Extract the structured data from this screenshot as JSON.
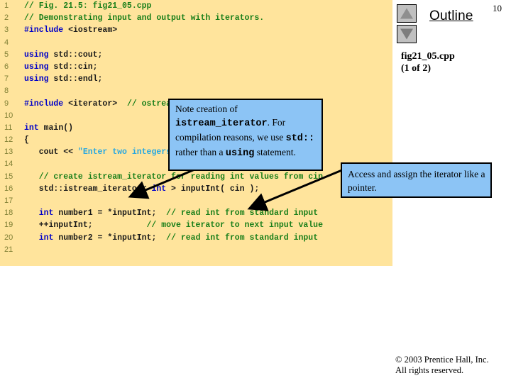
{
  "slide": {
    "number": "10",
    "outline_title": "Outline",
    "file_label_line1": "fig21_05.cpp",
    "file_label_line2": "(1 of 2)",
    "footer_line1": "© 2003 Prentice Hall, Inc.",
    "footer_line2": "All rights reserved."
  },
  "nav": {
    "up_icon": "triangle-up-icon",
    "down_icon": "triangle-down-icon"
  },
  "code": {
    "lines": [
      {
        "n": "1",
        "segments": [
          {
            "t": "// Fig. 21.5: fig21_05.cpp",
            "c": "cmt"
          }
        ]
      },
      {
        "n": "2",
        "segments": [
          {
            "t": "// Demonstrating input and output with iterators.",
            "c": "cmt"
          }
        ]
      },
      {
        "n": "3",
        "segments": [
          {
            "t": "#include",
            "c": "kw"
          },
          {
            "t": " <iostream>",
            "c": "pln"
          }
        ]
      },
      {
        "n": "4",
        "segments": []
      },
      {
        "n": "5",
        "segments": [
          {
            "t": "using",
            "c": "kw"
          },
          {
            "t": " std::cout;",
            "c": "pln"
          }
        ]
      },
      {
        "n": "6",
        "segments": [
          {
            "t": "using",
            "c": "kw"
          },
          {
            "t": " std::cin;",
            "c": "pln"
          }
        ]
      },
      {
        "n": "7",
        "segments": [
          {
            "t": "using",
            "c": "kw"
          },
          {
            "t": " std::endl;",
            "c": "pln"
          }
        ]
      },
      {
        "n": "8",
        "segments": []
      },
      {
        "n": "9",
        "segments": [
          {
            "t": "#include",
            "c": "kw"
          },
          {
            "t": " <iterator>  ",
            "c": "pln"
          },
          {
            "t": "// ostream_iterator and istream_iterator",
            "c": "cmt"
          }
        ]
      },
      {
        "n": "10",
        "segments": []
      },
      {
        "n": "11",
        "segments": [
          {
            "t": "int",
            "c": "kw"
          },
          {
            "t": " main()",
            "c": "pln"
          }
        ]
      },
      {
        "n": "12",
        "segments": [
          {
            "t": "{",
            "c": "pln"
          }
        ]
      },
      {
        "n": "13",
        "segments": [
          {
            "t": "   cout << ",
            "c": "pln"
          },
          {
            "t": "\"Enter two integers: \"",
            "c": "str"
          },
          {
            "t": ";",
            "c": "pln"
          }
        ]
      },
      {
        "n": "14",
        "segments": []
      },
      {
        "n": "15",
        "segments": [
          {
            "t": "   // create istream_iterator for reading int values from cin",
            "c": "cmt"
          }
        ]
      },
      {
        "n": "16",
        "segments": [
          {
            "t": "   std::istream_iterator< ",
            "c": "pln"
          },
          {
            "t": "int",
            "c": "kw"
          },
          {
            "t": " > inputInt( cin );",
            "c": "pln"
          }
        ]
      },
      {
        "n": "17",
        "segments": []
      },
      {
        "n": "18",
        "segments": [
          {
            "t": "   ",
            "c": "pln"
          },
          {
            "t": "int",
            "c": "kw"
          },
          {
            "t": " number1 = *inputInt;  ",
            "c": "pln"
          },
          {
            "t": "// read int from standard input",
            "c": "cmt"
          }
        ]
      },
      {
        "n": "19",
        "segments": [
          {
            "t": "   ++inputInt;           ",
            "c": "pln"
          },
          {
            "t": "// move iterator to next input value",
            "c": "cmt"
          }
        ]
      },
      {
        "n": "20",
        "segments": [
          {
            "t": "   ",
            "c": "pln"
          },
          {
            "t": "int",
            "c": "kw"
          },
          {
            "t": " number2 = *inputInt;  ",
            "c": "pln"
          },
          {
            "t": "// read int from standard input",
            "c": "cmt"
          }
        ]
      },
      {
        "n": "21",
        "segments": []
      }
    ]
  },
  "callouts": [
    {
      "id": "callout-note-creation",
      "parts": [
        {
          "t": "Note creation of ",
          "style": "normal"
        },
        {
          "t": "istream_iterator",
          "style": "mono"
        },
        {
          "t": ". For compilation reasons, we use ",
          "style": "normal"
        },
        {
          "t": "std::",
          "style": "mono"
        },
        {
          "t": " rather than a ",
          "style": "normal"
        },
        {
          "t": "using",
          "style": "mono"
        },
        {
          "t": " statement.",
          "style": "normal"
        }
      ]
    },
    {
      "id": "callout-access-assign",
      "parts": [
        {
          "t": "Access and assign the iterator like a pointer.",
          "style": "normal"
        }
      ]
    }
  ],
  "colors": {
    "code_background": "#ffe49c",
    "callout_background": "#8cc4f5",
    "keyword": "#0000c8",
    "comment": "#1a7f1a",
    "string": "#29a8e0",
    "line_number": "#7f7f34",
    "button_face": "#c0c0c0"
  }
}
